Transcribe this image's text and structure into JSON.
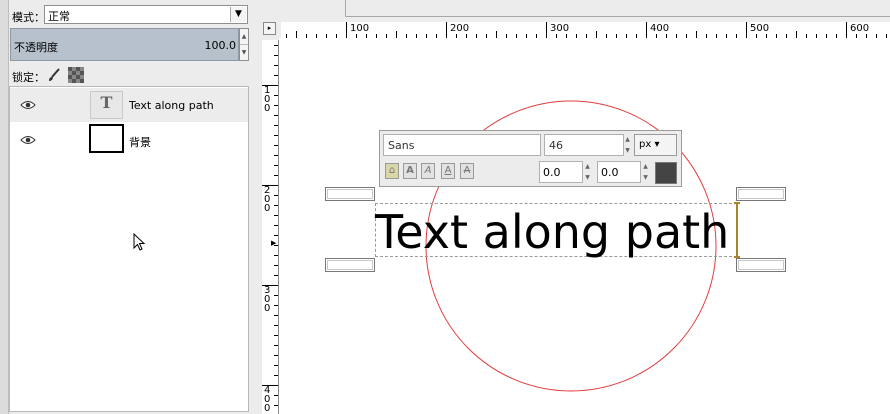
{
  "layers_panel": {
    "mode_label": "模式：",
    "mode_value": "正常",
    "opacity_label": "不透明度",
    "opacity_value": "100.0",
    "lock_label": "锁定：",
    "layers": [
      {
        "name": "Text along path",
        "type": "text",
        "visible": true,
        "selected": true
      },
      {
        "name": "背景",
        "type": "background",
        "visible": true,
        "selected": false
      }
    ]
  },
  "ruler": {
    "h_labels": [
      "100",
      "200",
      "300",
      "400",
      "500",
      "600"
    ],
    "v_labels": [
      "100",
      "200",
      "300",
      "400"
    ]
  },
  "text_editor": {
    "font": "Sans",
    "size": "46",
    "unit": "px",
    "kerning": "0.0",
    "baseline": "0.0",
    "text_color": "#444444"
  },
  "canvas": {
    "text": "Text along path",
    "path_color": "#e03c3c"
  }
}
